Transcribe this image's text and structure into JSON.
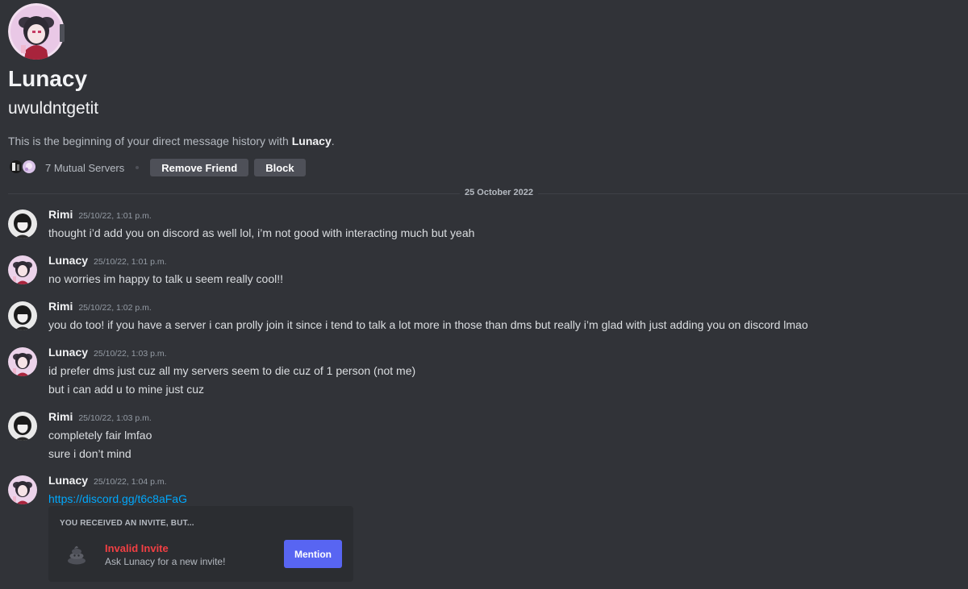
{
  "profile": {
    "display_name": "Lunacy",
    "username": "uwuldntgetit",
    "intro_prefix": "This is the beginning of your direct message history with ",
    "intro_name": "Lunacy",
    "intro_suffix": ".",
    "mutual_servers": "7 Mutual Servers",
    "remove_friend_label": "Remove Friend",
    "block_label": "Block"
  },
  "date_divider": "25 October 2022",
  "messages": [
    {
      "author": "Rimi",
      "timestamp": "25/10/22, 1:01 p.m.",
      "lines": [
        "thought i’d add you on discord as well lol, i’m not good with interacting much but yeah"
      ]
    },
    {
      "author": "Lunacy",
      "timestamp": "25/10/22, 1:01 p.m.",
      "lines": [
        "no worries im happy to talk u seem really cool!!"
      ]
    },
    {
      "author": "Rimi",
      "timestamp": "25/10/22, 1:02 p.m.",
      "lines": [
        "you do too! if you have a server i can prolly join it since i tend to talk a lot more in those than dms but really i’m glad with just adding you on discord lmao"
      ]
    },
    {
      "author": "Lunacy",
      "timestamp": "25/10/22, 1:03 p.m.",
      "lines": [
        "id prefer dms just cuz all my servers seem to die cuz of 1 person (not me)",
        "but i can add u to mine just cuz"
      ]
    },
    {
      "author": "Rimi",
      "timestamp": "25/10/22, 1:03 p.m.",
      "lines": [
        "completely fair lmfao",
        "sure i don’t mind"
      ]
    },
    {
      "author": "Lunacy",
      "timestamp": "25/10/22, 1:04 p.m.",
      "lines": [
        "https://discord.gg/t6c8aFaG"
      ]
    }
  ],
  "invite": {
    "title": "YOU RECEIVED AN INVITE, BUT...",
    "name": "Invalid Invite",
    "subtitle": "Ask Lunacy for a new invite!",
    "button_label": "Mention",
    "icon": "poop-icon"
  },
  "colors": {
    "background": "#313338",
    "embed_background": "#2b2d31",
    "link": "#00a8fc",
    "invalid": "#f23f43",
    "mention_button": "#5865f2"
  }
}
